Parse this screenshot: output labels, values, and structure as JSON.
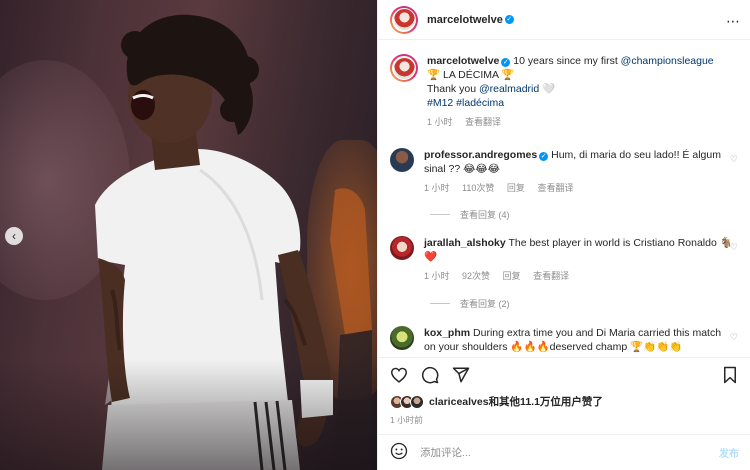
{
  "header": {
    "username": "marcelotwelve",
    "more_icon": "⋯"
  },
  "caption": {
    "username": "marcelotwelve",
    "text_1": "10 years since my first",
    "mention_1": "@championsleague",
    "line_2": "🏆 LA DÉCIMA 🏆",
    "line_3_prefix": "Thank you",
    "mention_2": "@realmadrid",
    "line_3_suffix": "🤍",
    "hashtags": "#M12 #ladécima",
    "time": "1 小时",
    "translate": "查看翻译"
  },
  "comments": [
    {
      "username": "professor.andregomes",
      "verified": true,
      "text": "Hum, di maria do seu lado!! É algum sinal ?? 😂😂😂",
      "time": "1 小时",
      "likes": "110次赞",
      "reply": "回复",
      "translate": "查看翻译",
      "view_replies": "查看回复 (4)"
    },
    {
      "username": "jarallah_alshoky",
      "verified": false,
      "text": "The best player in world is Cristiano Ronaldo 🐐❤️",
      "time": "1 小时",
      "likes": "92次赞",
      "reply": "回复",
      "translate": "查看翻译",
      "view_replies": "查看回复 (2)"
    },
    {
      "username": "kox_phm",
      "verified": false,
      "text": "During extra time you and Di Maria carried this match on your shoulders 🔥🔥🔥deserved champ 🏆👏👏👏"
    }
  ],
  "likes": {
    "username": "claricealves",
    "suffix": "和其他11.1万位用户赞了"
  },
  "post_time": "1 小时前",
  "composer": {
    "placeholder": "添加评论...",
    "post_label": "发布"
  },
  "colors": {
    "verified": "#0095f6",
    "link": "#00376b",
    "muted": "#8e8e8e",
    "jersey": "#f2f2f2"
  }
}
